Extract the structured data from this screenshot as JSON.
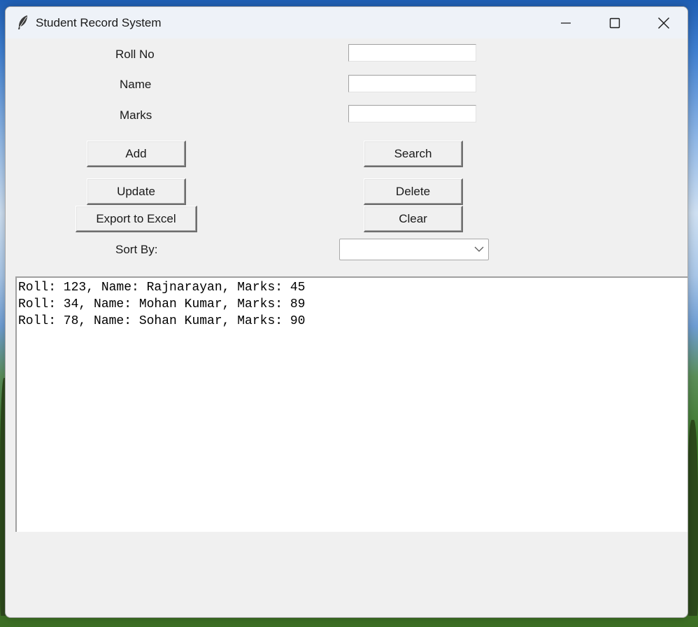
{
  "window": {
    "title": "Student Record System",
    "app_icon": "feather-icon"
  },
  "form": {
    "roll_label": "Roll No",
    "name_label": "Name",
    "marks_label": "Marks",
    "roll_value": "",
    "name_value": "",
    "marks_value": ""
  },
  "buttons": {
    "add": "Add",
    "search": "Search",
    "update": "Update",
    "delete": "Delete",
    "export": "Export to Excel",
    "clear": "Clear"
  },
  "sort": {
    "label": "Sort By:",
    "selected": ""
  },
  "records": [
    "Roll: 123, Name: Rajnarayan, Marks: 45",
    "Roll: 34, Name: Mohan Kumar, Marks: 89",
    "Roll: 78, Name: Sohan Kumar, Marks: 90"
  ]
}
